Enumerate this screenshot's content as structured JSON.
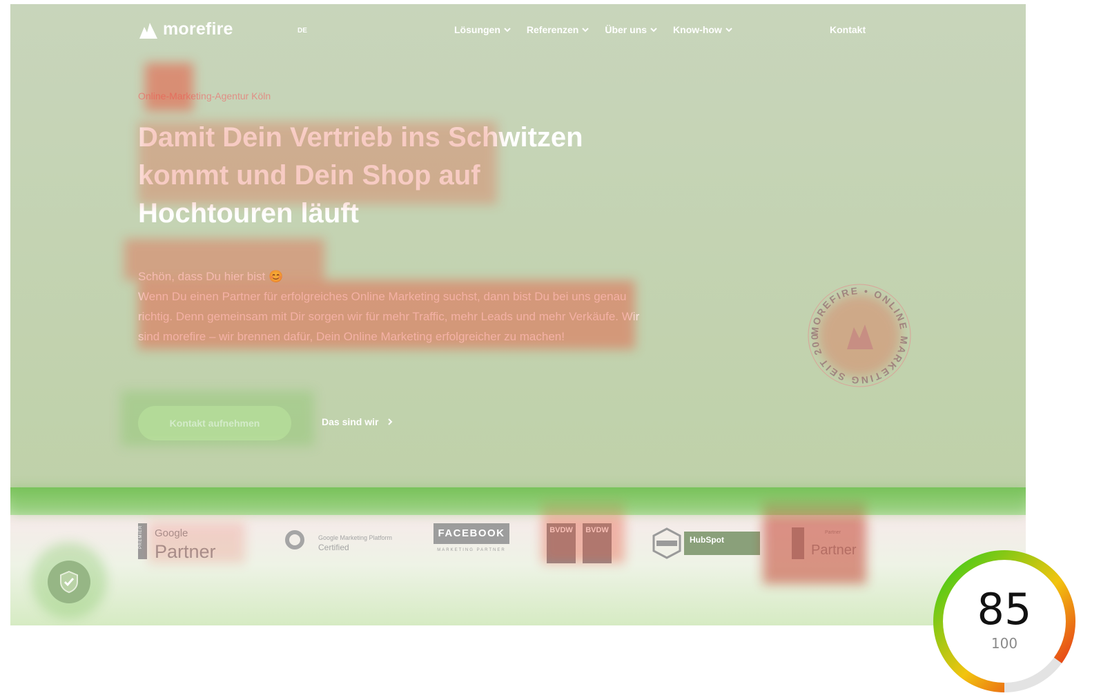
{
  "header": {
    "brand": "morefire",
    "language": "DE",
    "menu": [
      {
        "label": "Lösungen"
      },
      {
        "label": "Referenzen"
      },
      {
        "label": "Über uns"
      },
      {
        "label": "Know-how"
      }
    ],
    "contact": "Kontakt"
  },
  "hero": {
    "eyebrow": "Online-Marketing-Agentur Köln",
    "headline": "Damit Dein Vertrieb ins Schwitzen kommt und Dein Shop auf Hochtouren läuft",
    "greeting": "Schön, dass Du hier bist 😊",
    "body": "Wenn Du einen Partner für erfolgreiches Online Marketing suchst, dann bist Du bei uns genau richtig. Denn gemeinsam mit Dir sorgen wir für mehr Traffic, mehr Leads und mehr Verkäufe. Wir sind morefire – wir brennen dafür, Dein Online Marketing erfolgreicher zu machen!",
    "cta_primary": "Kontakt aufnehmen",
    "cta_secondary": "Das sind wir",
    "seal_text": "MOREFIRE • ONLINE MARKETING SEIT 2005 • "
  },
  "badges": {
    "google_vertical": "PREMIER",
    "google_line1": "Google",
    "google_line2": "Partner",
    "gmp_line1": "Google Marketing Platform",
    "gmp_line2": "Certified",
    "facebook": "FACEBOOK",
    "facebook_sub": "MARKETING PARTNER",
    "bvdw": "BVDW",
    "hubspot": "HubSpot",
    "partner_small": "Partner",
    "partner_word": "Partner"
  },
  "score": {
    "value": "85",
    "max": "100",
    "fraction": 0.85
  },
  "colors": {
    "heat_hot": "#e8553d",
    "heat_cool": "#7ac35a",
    "score_gradient": [
      "#2ecc1a",
      "#f2c40f",
      "#e31b1b"
    ]
  }
}
